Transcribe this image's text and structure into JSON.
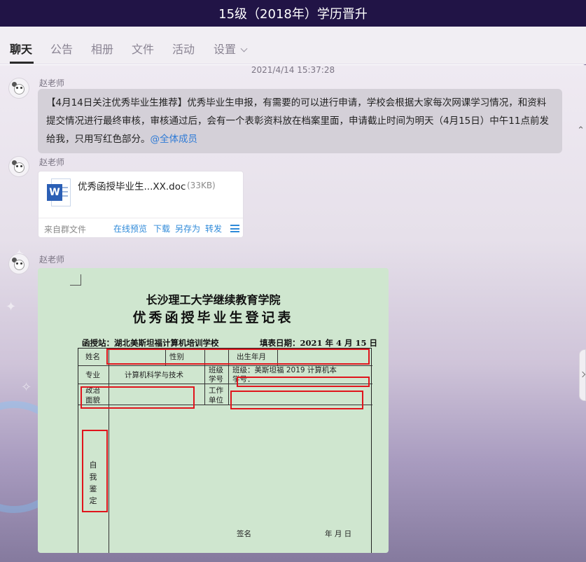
{
  "window": {
    "title": "15级（2018年）学历晋升"
  },
  "tabs": [
    {
      "label": "聊天",
      "active": true
    },
    {
      "label": "公告"
    },
    {
      "label": "相册"
    },
    {
      "label": "文件"
    },
    {
      "label": "活动"
    },
    {
      "label": "设置"
    }
  ],
  "chat": {
    "timestamp": "2021/4/14 15:37:28",
    "messages": [
      {
        "sender": "赵老师",
        "text": "【4月14日关注优秀毕业生推荐】优秀毕业生申报，有需要的可以进行申请，学校会根据大家每次网课学习情况，和资料提交情况进行最终审核，审核通过后，会有一个表彰资料放在档案里面，申请截止时间为明天（4月15日）中午11点前发给我，只用写红色部分。",
        "mention": "@全体成员"
      },
      {
        "sender": "赵老师",
        "file": {
          "icon": "word-doc-icon",
          "icon_letter": "W",
          "name": "优秀函授毕业生...XX.doc",
          "size": "(33KB)",
          "source": "来自群文件",
          "actions": [
            "在线预览",
            "下载",
            "另存为",
            "转发"
          ]
        }
      },
      {
        "sender": "赵老师",
        "image": {
          "school": "长沙理工大学继续教育学院",
          "title": "优秀函授毕业生登记表",
          "station": "函授站：湖北美斯坦福计算机培训学校",
          "fill_date": "填表日期：2021 年 4 月 15 日",
          "fields": {
            "name": "姓名",
            "gender": "性别",
            "birth": "出生年月",
            "major": "专业",
            "major_value": "计算机科学与技术",
            "class_id_1": "班级",
            "class_id_2": "学号",
            "class_value": "班级：美斯坦福 2019 计算机本",
            "student_no": "学号：",
            "politics_1": "政治",
            "politics_2": "面貌",
            "work_1": "工作",
            "work_2": "单位",
            "self_eval": [
              "自",
              "我",
              "鉴",
              "定"
            ],
            "signature": "签名",
            "date_tail": "年    月    日"
          },
          "highlight_color": "#e0141c",
          "background_color": "#cfe6cf"
        }
      }
    ]
  },
  "colors": {
    "titlebar": "#211446",
    "link": "#2f7bd6",
    "file_action": "#2f8ad9"
  }
}
